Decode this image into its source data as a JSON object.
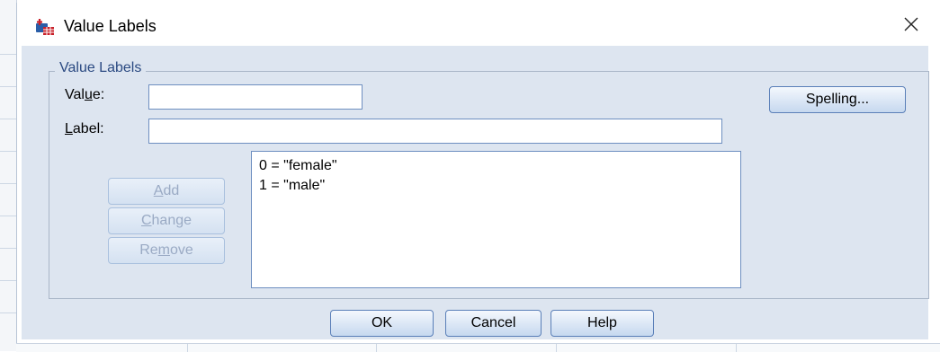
{
  "window": {
    "title": "Value Labels",
    "close_symbol": "✕"
  },
  "group": {
    "title": "Value Labels"
  },
  "fields": {
    "value": {
      "label_pre": "Val",
      "label_mnemonic": "u",
      "label_post": "e:",
      "value": ""
    },
    "label": {
      "label_mnemonic": "L",
      "label_post": "abel:",
      "value": ""
    }
  },
  "list": {
    "items": [
      "0 = \"female\"",
      "1 = \"male\""
    ]
  },
  "buttons": {
    "add": {
      "mnemonic": "A",
      "rest": "dd",
      "enabled": false
    },
    "change": {
      "mnemonic": "C",
      "rest": "hange",
      "enabled": false
    },
    "remove": {
      "pre": "Re",
      "mnemonic": "m",
      "rest": "ove",
      "enabled": false
    },
    "spelling": "Spelling...",
    "ok": "OK",
    "cancel": "Cancel",
    "help": "Help"
  },
  "colors": {
    "dialog_body": "#dde5f0",
    "group_title": "#2b4a82",
    "button_border": "#5a7fb8",
    "disabled_text": "#9aaac4"
  }
}
